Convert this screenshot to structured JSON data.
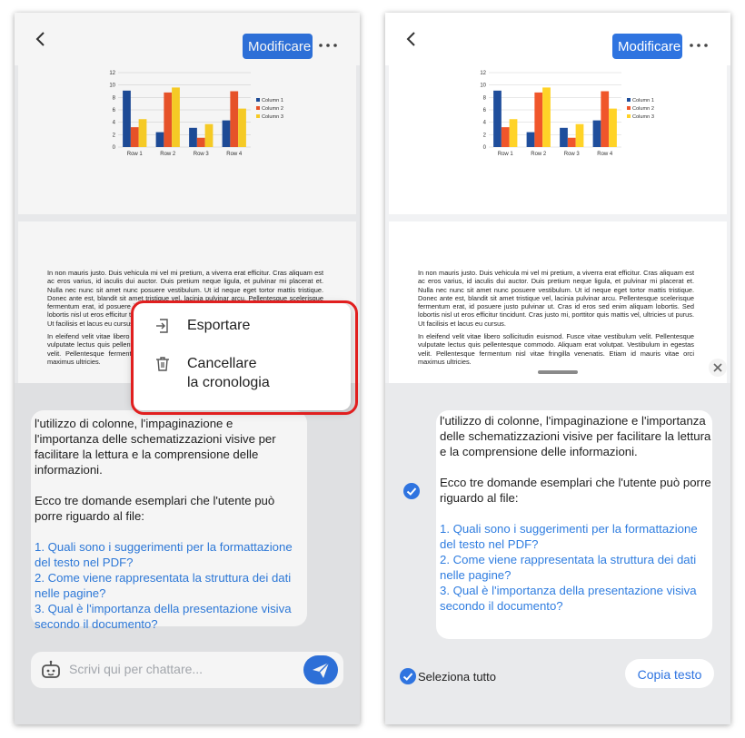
{
  "header": {
    "edit_label": "Modificare"
  },
  "chart_data": {
    "type": "bar",
    "categories": [
      "Row 1",
      "Row 2",
      "Row 3",
      "Row 4"
    ],
    "series": [
      {
        "name": "Column 1",
        "color": "#1f4e9c",
        "values": [
          9.1,
          2.4,
          3.1,
          4.3
        ]
      },
      {
        "name": "Column 2",
        "color": "#f0562b",
        "values": [
          3.2,
          8.8,
          1.5,
          9.0
        ]
      },
      {
        "name": "Column 3",
        "color": "#ffd327",
        "values": [
          4.5,
          9.6,
          3.7,
          6.2
        ]
      }
    ],
    "yticks": [
      "0",
      "2",
      "4",
      "6",
      "8",
      "10",
      "12"
    ],
    "ylim": [
      0,
      12
    ],
    "grid": true,
    "legend": "right"
  },
  "document": {
    "para1": "In non mauris justo. Duis vehicula mi vel mi pretium, a viverra erat efficitur. Cras aliquam est ac eros varius, id iaculis dui auctor. Duis pretium neque ligula, et pulvinar mi placerat et. Nulla nec nunc sit amet nunc posuere vestibulum. Ut id neque eget tortor mattis tristique. Donec ante est, blandit sit amet tristique vel, lacinia pulvinar arcu. Pellentesque scelerisque fermentum erat, id posuere justo pulvinar ut. Cras id eros sed enim aliquam lobortis. Sed lobortis nisl ut eros efficitur tincidunt. Cras justo mi, porttitor quis mattis vel, ultricies ut purus. Ut facilisis et lacus eu cursus.",
    "para2": "In eleifend velit vitae libero sollicitudin euismod. Fusce vitae vestibulum velit. Pellentesque vulputate lectus quis pellentesque commodo. Aliquam erat volutpat. Vestibulum in egestas velit. Pellentesque fermentum nisl vitae fringilla venenatis. Etiam id mauris vitae orci maximus ultricies."
  },
  "chat": {
    "left_lines": [
      "l'utilizzo di colonne, l'impaginazione e",
      "l'importanza delle schematizzazioni visive per facilitare la lettura e la comprensione delle informazioni."
    ],
    "right_intro": "l'utilizzo di colonne, l'impaginazione e l'importanza delle schematizzazioni visive per facilitare la lettura e la comprensione delle informazioni.",
    "lead": "Ecco tre domande esemplari che l'utente può porre riguardo al file:",
    "q1": "1. Quali sono i suggerimenti per la formattazione del testo nel PDF?",
    "q2": "2. Come viene rappresentata la struttura dei dati nelle pagine?",
    "q3": "3. Qual è l'importanza della presentazione visiva secondo il documento?",
    "input_placeholder": "Scrivi qui per chattare..."
  },
  "context_menu": {
    "export_label": "Esportare",
    "clear_label_line1": "Cancellare",
    "clear_label_line2": "la cronologia"
  },
  "selection_bar": {
    "select_all_label": "Seleziona tutto",
    "copy_label": "Copia testo"
  }
}
